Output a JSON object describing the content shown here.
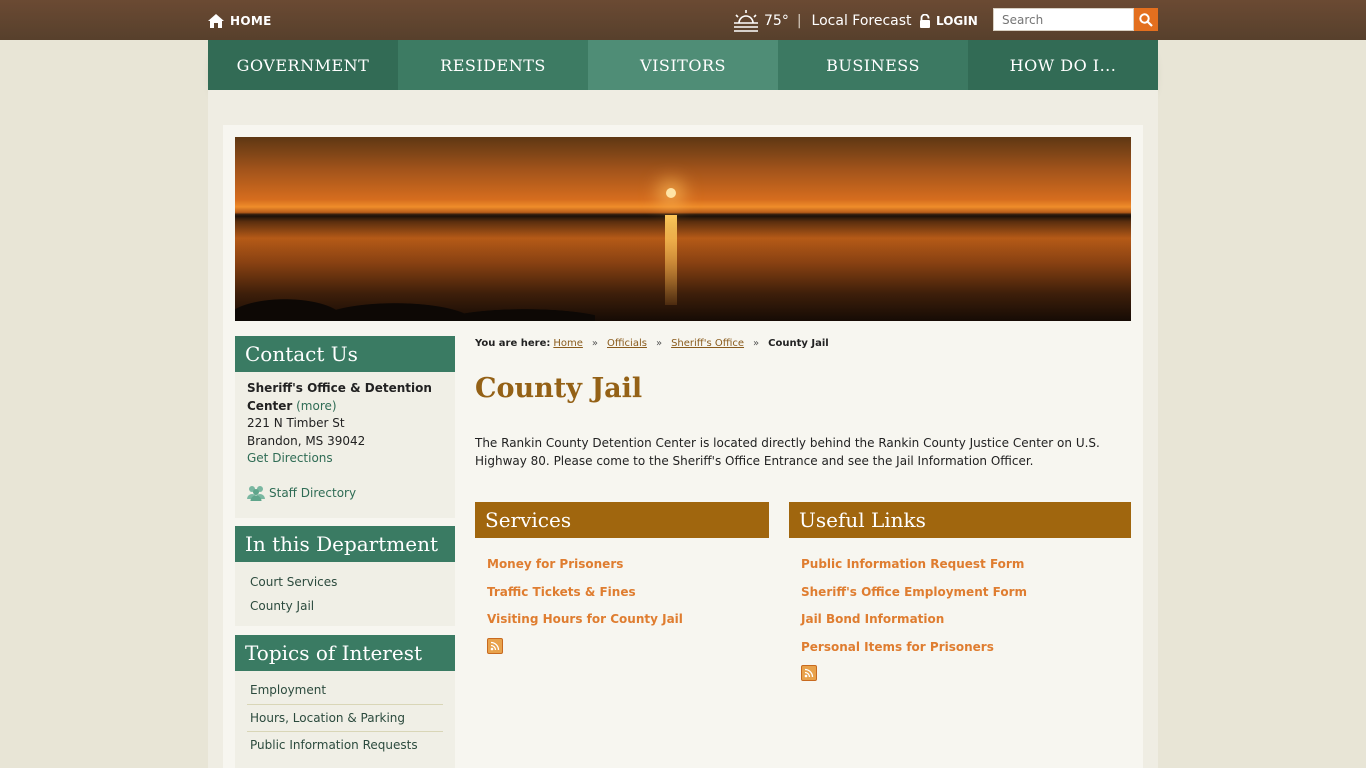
{
  "topbar": {
    "home_label": "HOME",
    "temperature": "75°",
    "separator": "|",
    "forecast_label": "Local Forecast",
    "login_label": "LOGIN",
    "search_placeholder": "Search"
  },
  "nav": {
    "items": [
      {
        "label": "GOVERNMENT"
      },
      {
        "label": "RESIDENTS"
      },
      {
        "label": "VISITORS"
      },
      {
        "label": "BUSINESS"
      },
      {
        "label": "HOW DO I..."
      }
    ]
  },
  "sidebar": {
    "contact": {
      "title": "Contact Us",
      "org": "Sheriff's Office & Detention Center",
      "more": "(more)",
      "street": "221 N Timber St",
      "city": "Brandon, MS 39042",
      "directions": "Get Directions",
      "staff": "Staff Directory"
    },
    "department": {
      "title": "In this Department",
      "items": [
        "Court Services",
        "County Jail"
      ]
    },
    "topics": {
      "title": "Topics of Interest",
      "items": [
        "Employment",
        "Hours, Location & Parking",
        "Public Information Requests"
      ]
    }
  },
  "breadcrumb": {
    "label": "You are here:",
    "items": [
      "Home",
      "Officials",
      "Sheriff's Office"
    ],
    "current": "County Jail",
    "arrow": "»"
  },
  "main": {
    "title": "County Jail",
    "intro": "The Rankin County Detention Center is located directly behind the Rankin County Justice Center on U.S. Highway 80. Please come to the Sheriff's Office Entrance and see the Jail Information Officer.",
    "services": {
      "title": "Services",
      "items": [
        "Money for Prisoners",
        "Traffic Tickets & Fines",
        "Visiting Hours for County Jail"
      ]
    },
    "useful_links": {
      "title": "Useful Links",
      "items": [
        "Public Information Request Form",
        "Sheriff's Office Employment Form",
        "Jail Bond Information",
        "Personal Items for Prisoners"
      ]
    }
  },
  "colors": {
    "topbar": "#5e432f",
    "nav_green": "#3a7b63",
    "gold": "#a0660e",
    "link_orange": "#df7d30",
    "search_button": "#e36f1e"
  }
}
